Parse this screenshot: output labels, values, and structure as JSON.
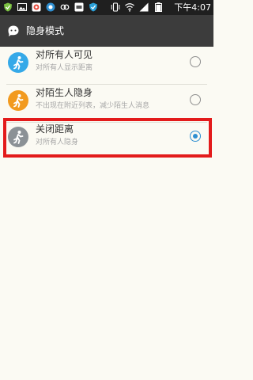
{
  "status_bar": {
    "time": "下午4:07",
    "icons": [
      "shield-icon",
      "image-icon",
      "photo-app-icon",
      "browser-icon",
      "link-icon",
      "hd-app-icon",
      "vpn-icon",
      "signal-app-icon",
      "vibrate-icon",
      "wifi-icon",
      "cellular-icon",
      "battery-icon"
    ]
  },
  "app_bar": {
    "title": "隐身模式",
    "icon": "chat-bubble-icon"
  },
  "options": [
    {
      "title": "对所有人可见",
      "subtitle": "对所有人显示距离",
      "avatar_color": "#35a9e8",
      "selected": false
    },
    {
      "title": "对陌生人隐身",
      "subtitle": "不出现在附近列表，减少陌生人消息",
      "avatar_color": "#f29a1f",
      "selected": false
    },
    {
      "title": "关闭距离",
      "subtitle": "对所有人隐身",
      "avatar_color": "#8b9196",
      "selected": true
    }
  ],
  "colors": {
    "accent": "#2f8fd1",
    "highlight": "#e31b1b",
    "app_bar": "#3c3c3c",
    "background": "#fbfaf3"
  }
}
